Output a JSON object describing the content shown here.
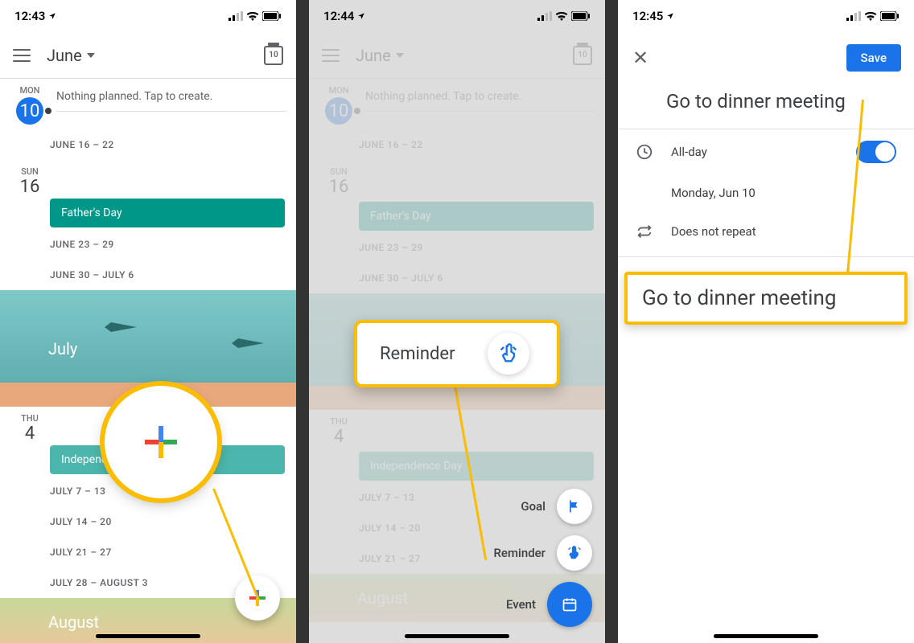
{
  "panel1": {
    "status": {
      "time": "12:43"
    },
    "header": {
      "month": "June",
      "today_num": "10"
    },
    "today": {
      "day_name": "MON",
      "day_num": "10",
      "nothing": "Nothing planned. Tap to create."
    },
    "weeks": [
      "JUNE 16 – 22",
      "JUNE 23 – 29",
      "JUNE 30 – JULY 6"
    ],
    "fathers": {
      "day_name": "SUN",
      "day_num": "16",
      "label": "Father's Day"
    },
    "july_label": "July",
    "july4": {
      "day_name": "THU",
      "day_num": "4",
      "label": "Independ"
    },
    "july_weeks": [
      "JULY 7 – 13",
      "JULY 14 – 20",
      "JULY 21 – 27",
      "JULY 28 – AUGUST 3"
    ],
    "august_label": "August"
  },
  "panel2": {
    "status": {
      "time": "12:44"
    },
    "header": {
      "month": "June"
    },
    "callout_label": "Reminder",
    "dial": {
      "goal": "Goal",
      "reminder": "Reminder",
      "event": "Event"
    }
  },
  "panel3": {
    "status": {
      "time": "12:45"
    },
    "save": "Save",
    "title": "Go to dinner meeting",
    "allday": "All-day",
    "date": "Monday, Jun 10",
    "repeat": "Does not repeat",
    "callout": "Go to dinner meeting"
  }
}
